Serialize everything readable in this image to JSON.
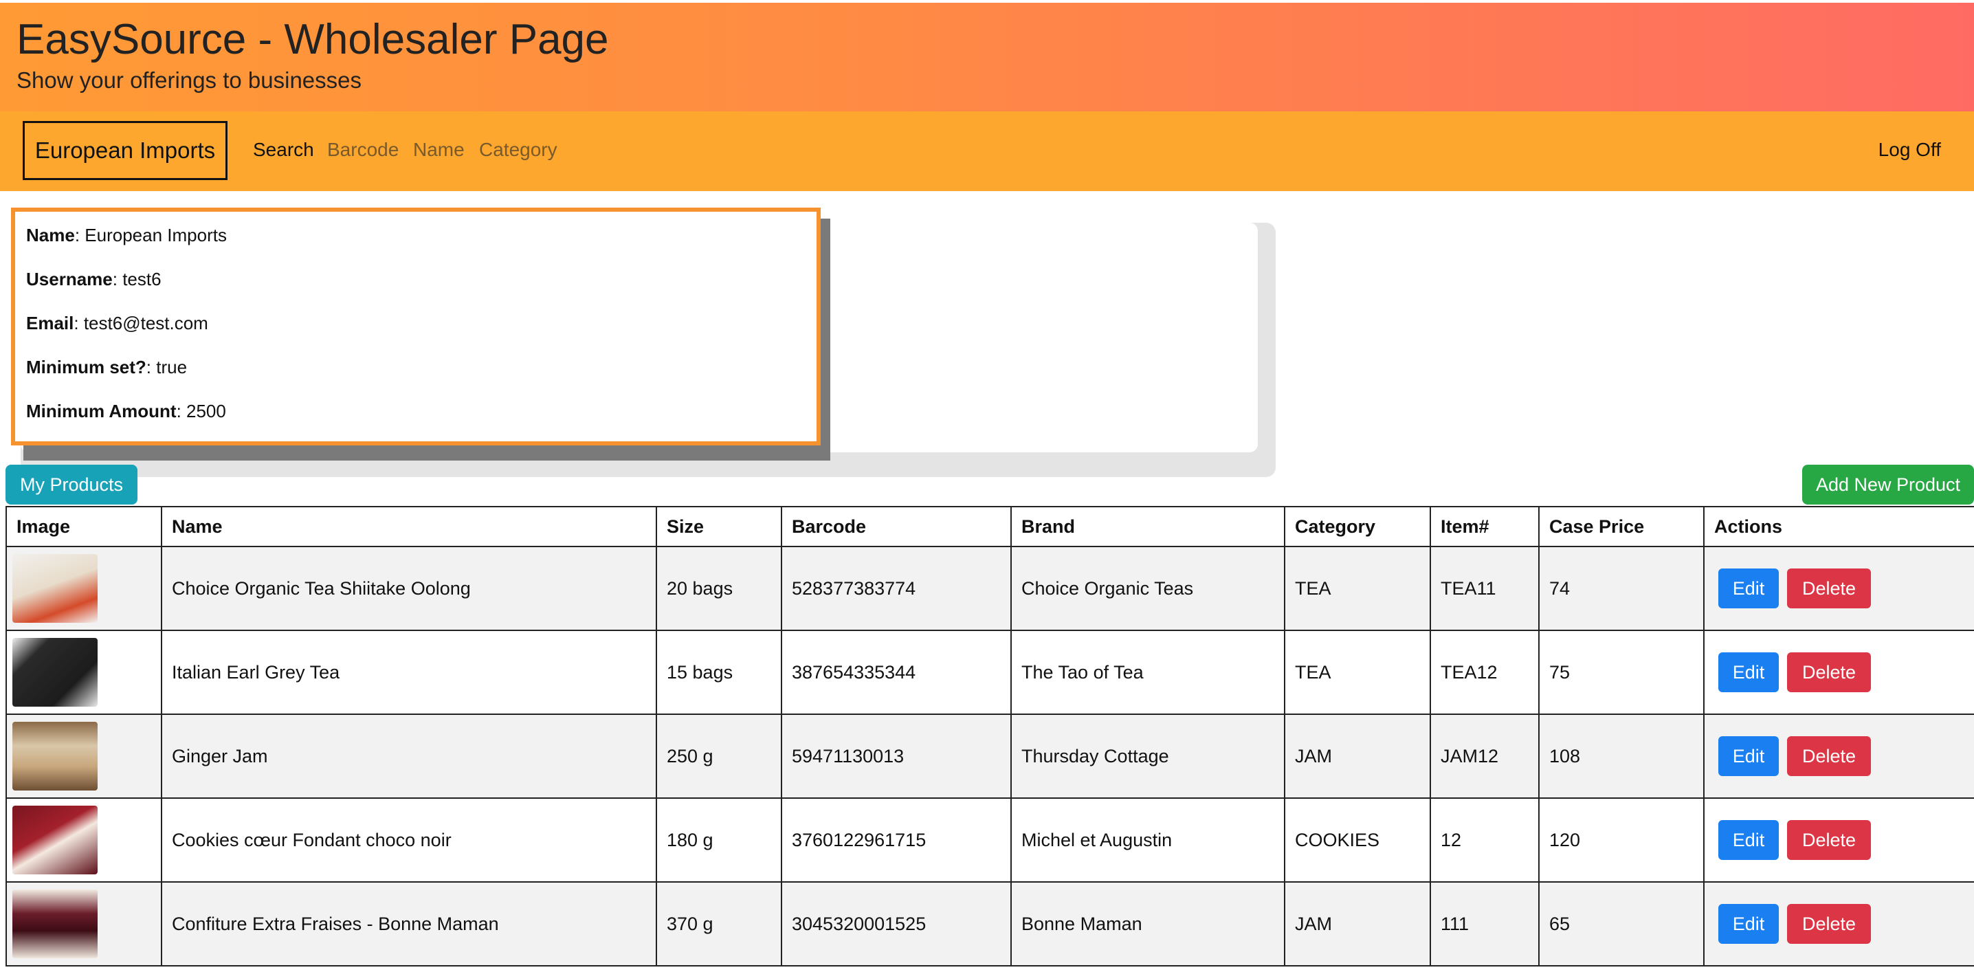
{
  "header": {
    "title": "EasySource - Wholesaler Page",
    "subtitle": "Show your offerings to businesses"
  },
  "navbar": {
    "brand": "European Imports",
    "links": [
      "Search",
      "Barcode",
      "Name",
      "Category"
    ],
    "logoff": "Log Off"
  },
  "profile": {
    "name_label": "Name",
    "name_value": "European Imports",
    "username_label": "Username",
    "username_value": "test6",
    "email_label": "Email",
    "email_value": "test6@test.com",
    "minimum_set_label": "Minimum set?",
    "minimum_set_value": "true",
    "minimum_amount_label": "Minimum Amount",
    "minimum_amount_value": "2500"
  },
  "buttons": {
    "my_products": "My Products",
    "add_new_product": "Add New Product"
  },
  "table": {
    "headers": [
      "Image",
      "Name",
      "Size",
      "Barcode",
      "Brand",
      "Category",
      "Item#",
      "Case Price",
      "Actions"
    ],
    "rows": [
      {
        "name": "Choice Organic Tea Shiitake Oolong",
        "size": "20 bags",
        "barcode": "528377383774",
        "brand": "Choice Organic Teas",
        "category": "TEA",
        "item": "TEA11",
        "price": "74",
        "edit": "Edit",
        "delete": "Delete"
      },
      {
        "name": "Italian Earl Grey Tea",
        "size": "15 bags",
        "barcode": "387654335344",
        "brand": "The Tao of Tea",
        "category": "TEA",
        "item": "TEA12",
        "price": "75",
        "edit": "Edit",
        "delete": "Delete"
      },
      {
        "name": "Ginger Jam",
        "size": "250 g",
        "barcode": "59471130013",
        "brand": "Thursday Cottage",
        "category": "JAM",
        "item": "JAM12",
        "price": "108",
        "edit": "Edit",
        "delete": "Delete"
      },
      {
        "name": "Cookies cœur Fondant choco noir",
        "size": "180 g",
        "barcode": "3760122961715",
        "brand": "Michel et Augustin",
        "category": "COOKIES",
        "item": "12",
        "price": "120",
        "edit": "Edit",
        "delete": "Delete"
      },
      {
        "name": "Confiture Extra Fraises - Bonne Maman",
        "size": "370 g",
        "barcode": "3045320001525",
        "brand": "Bonne Maman",
        "category": "JAM",
        "item": "111",
        "price": "65",
        "edit": "Edit",
        "delete": "Delete"
      }
    ]
  },
  "colors": {
    "banner_start": "#ff9a35",
    "banner_end": "#ff6b63",
    "navbar": "#fea72e",
    "info_border": "#f6932f",
    "my_products_button": "#17a2b8",
    "add_button": "#28a745",
    "edit_button": "#1a7ff0",
    "delete_button": "#dc3545"
  }
}
